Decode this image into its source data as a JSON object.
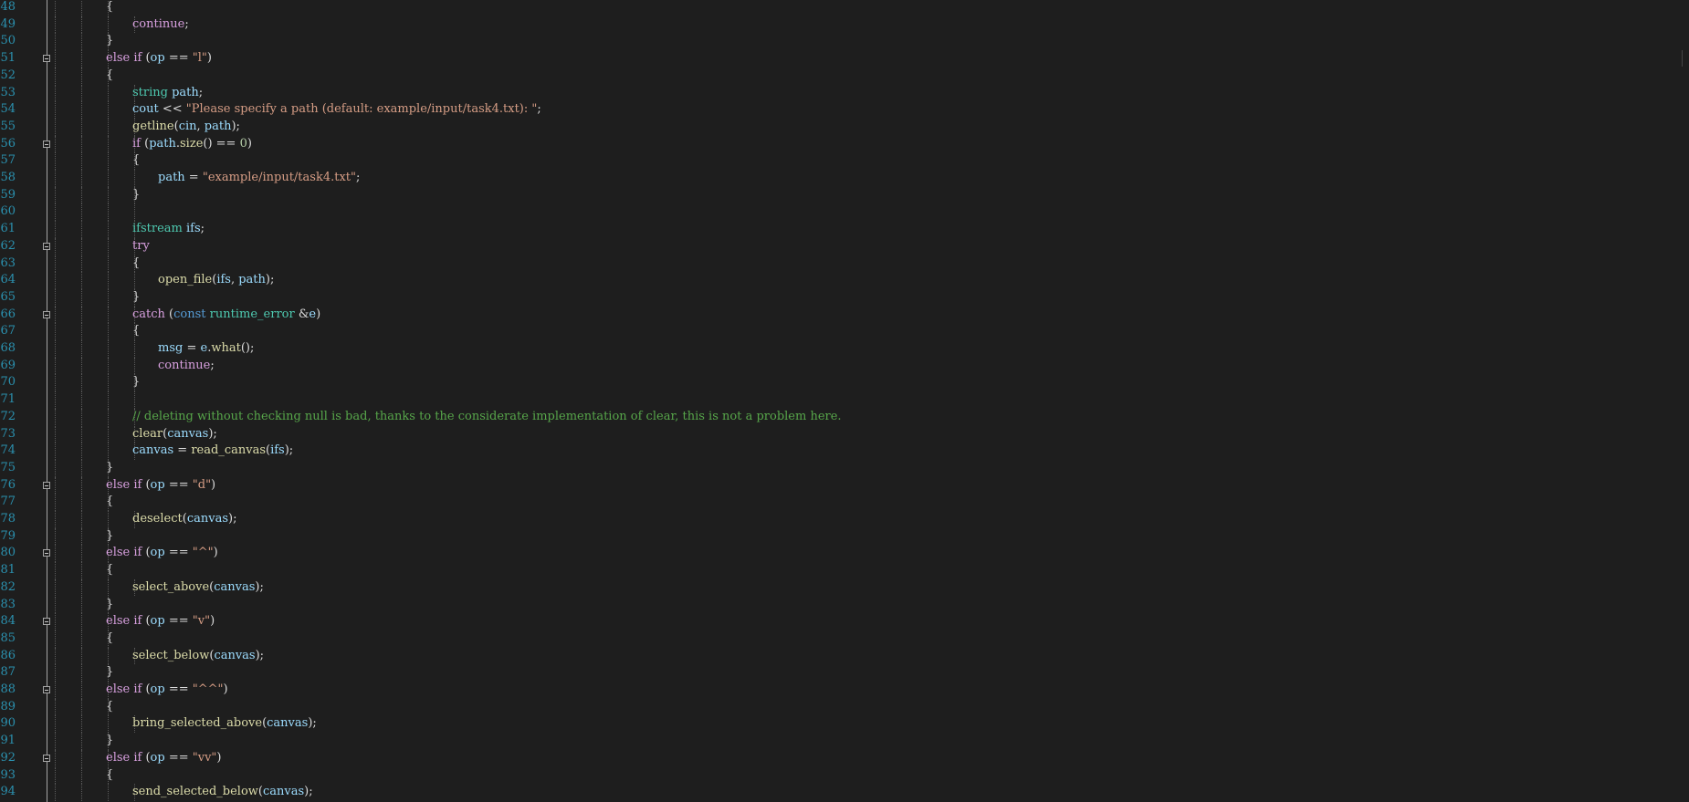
{
  "editor": {
    "lines": [
      {
        "n": "48",
        "indent": 4,
        "fold": false,
        "code": [
          [
            "{",
            "punc"
          ]
        ]
      },
      {
        "n": "49",
        "indent": 5,
        "fold": false,
        "code": [
          [
            "continue",
            "kw"
          ],
          [
            ";",
            "punc"
          ]
        ]
      },
      {
        "n": "50",
        "indent": 4,
        "fold": false,
        "code": [
          [
            "}",
            "punc"
          ]
        ]
      },
      {
        "n": "51",
        "indent": 4,
        "fold": true,
        "code": [
          [
            "else if",
            "kw"
          ],
          [
            " (",
            "punc"
          ],
          [
            "op",
            "var"
          ],
          [
            " == ",
            "punc"
          ],
          [
            "\"l\"",
            "str"
          ],
          [
            ")",
            "punc"
          ]
        ]
      },
      {
        "n": "52",
        "indent": 4,
        "fold": false,
        "code": [
          [
            "{",
            "punc"
          ]
        ]
      },
      {
        "n": "53",
        "indent": 5,
        "fold": false,
        "code": [
          [
            "string",
            "type"
          ],
          [
            " ",
            "punc"
          ],
          [
            "path",
            "var"
          ],
          [
            ";",
            "punc"
          ]
        ]
      },
      {
        "n": "54",
        "indent": 5,
        "fold": false,
        "code": [
          [
            "cout",
            "var"
          ],
          [
            " << ",
            "punc"
          ],
          [
            "\"Please specify a path (default: example/input/task4.txt): \"",
            "str"
          ],
          [
            ";",
            "punc"
          ]
        ]
      },
      {
        "n": "55",
        "indent": 5,
        "fold": false,
        "code": [
          [
            "getline",
            "fn"
          ],
          [
            "(",
            "punc"
          ],
          [
            "cin",
            "var"
          ],
          [
            ", ",
            "punc"
          ],
          [
            "path",
            "var"
          ],
          [
            ");",
            "punc"
          ]
        ]
      },
      {
        "n": "56",
        "indent": 5,
        "fold": true,
        "code": [
          [
            "if",
            "kw"
          ],
          [
            " (",
            "punc"
          ],
          [
            "path",
            "var"
          ],
          [
            ".",
            "punc"
          ],
          [
            "size",
            "fn"
          ],
          [
            "() == ",
            "punc"
          ],
          [
            "0",
            "num"
          ],
          [
            ")",
            "punc"
          ]
        ]
      },
      {
        "n": "57",
        "indent": 5,
        "fold": false,
        "code": [
          [
            "{",
            "punc"
          ]
        ]
      },
      {
        "n": "58",
        "indent": 6,
        "fold": false,
        "code": [
          [
            "path",
            "var"
          ],
          [
            " = ",
            "punc"
          ],
          [
            "\"example/input/task4.txt\"",
            "str"
          ],
          [
            ";",
            "punc"
          ]
        ]
      },
      {
        "n": "59",
        "indent": 5,
        "fold": false,
        "code": [
          [
            "}",
            "punc"
          ]
        ]
      },
      {
        "n": "60",
        "indent": 5,
        "fold": false,
        "code": []
      },
      {
        "n": "61",
        "indent": 5,
        "fold": false,
        "code": [
          [
            "ifstream",
            "type"
          ],
          [
            " ",
            "punc"
          ],
          [
            "ifs",
            "var"
          ],
          [
            ";",
            "punc"
          ]
        ]
      },
      {
        "n": "62",
        "indent": 5,
        "fold": true,
        "code": [
          [
            "try",
            "kw"
          ]
        ]
      },
      {
        "n": "63",
        "indent": 5,
        "fold": false,
        "code": [
          [
            "{",
            "punc"
          ]
        ]
      },
      {
        "n": "64",
        "indent": 6,
        "fold": false,
        "code": [
          [
            "open_file",
            "fn"
          ],
          [
            "(",
            "punc"
          ],
          [
            "ifs",
            "var"
          ],
          [
            ", ",
            "punc"
          ],
          [
            "path",
            "var"
          ],
          [
            ");",
            "punc"
          ]
        ]
      },
      {
        "n": "65",
        "indent": 5,
        "fold": false,
        "code": [
          [
            "}",
            "punc"
          ]
        ]
      },
      {
        "n": "66",
        "indent": 5,
        "fold": true,
        "code": [
          [
            "catch",
            "kw"
          ],
          [
            " (",
            "punc"
          ],
          [
            "const",
            "kwb"
          ],
          [
            " ",
            "punc"
          ],
          [
            "runtime_error",
            "type"
          ],
          [
            " &",
            "punc"
          ],
          [
            "e",
            "var"
          ],
          [
            ")",
            "punc"
          ]
        ]
      },
      {
        "n": "67",
        "indent": 5,
        "fold": false,
        "code": [
          [
            "{",
            "punc"
          ]
        ]
      },
      {
        "n": "68",
        "indent": 6,
        "fold": false,
        "code": [
          [
            "msg",
            "var"
          ],
          [
            " = ",
            "punc"
          ],
          [
            "e",
            "var"
          ],
          [
            ".",
            "punc"
          ],
          [
            "what",
            "fn"
          ],
          [
            "();",
            "punc"
          ]
        ]
      },
      {
        "n": "69",
        "indent": 6,
        "fold": false,
        "code": [
          [
            "continue",
            "kw"
          ],
          [
            ";",
            "punc"
          ]
        ]
      },
      {
        "n": "70",
        "indent": 5,
        "fold": false,
        "code": [
          [
            "}",
            "punc"
          ]
        ]
      },
      {
        "n": "71",
        "indent": 5,
        "fold": false,
        "code": []
      },
      {
        "n": "72",
        "indent": 5,
        "fold": false,
        "code": [
          [
            "// deleting without checking null is bad, thanks to the considerate implementation of clear, this is not a problem here.",
            "cmt"
          ]
        ]
      },
      {
        "n": "73",
        "indent": 5,
        "fold": false,
        "code": [
          [
            "clear",
            "fn"
          ],
          [
            "(",
            "punc"
          ],
          [
            "canvas",
            "var"
          ],
          [
            ");",
            "punc"
          ]
        ]
      },
      {
        "n": "74",
        "indent": 5,
        "fold": false,
        "code": [
          [
            "canvas",
            "var"
          ],
          [
            " = ",
            "punc"
          ],
          [
            "read_canvas",
            "fn"
          ],
          [
            "(",
            "punc"
          ],
          [
            "ifs",
            "var"
          ],
          [
            ");",
            "punc"
          ]
        ]
      },
      {
        "n": "75",
        "indent": 4,
        "fold": false,
        "code": [
          [
            "}",
            "punc"
          ]
        ]
      },
      {
        "n": "76",
        "indent": 4,
        "fold": true,
        "code": [
          [
            "else if",
            "kw"
          ],
          [
            " (",
            "punc"
          ],
          [
            "op",
            "var"
          ],
          [
            " == ",
            "punc"
          ],
          [
            "\"d\"",
            "str"
          ],
          [
            ")",
            "punc"
          ]
        ]
      },
      {
        "n": "77",
        "indent": 4,
        "fold": false,
        "code": [
          [
            "{",
            "punc"
          ]
        ]
      },
      {
        "n": "78",
        "indent": 5,
        "fold": false,
        "code": [
          [
            "deselect",
            "fn"
          ],
          [
            "(",
            "punc"
          ],
          [
            "canvas",
            "var"
          ],
          [
            ");",
            "punc"
          ]
        ]
      },
      {
        "n": "79",
        "indent": 4,
        "fold": false,
        "code": [
          [
            "}",
            "punc"
          ]
        ]
      },
      {
        "n": "80",
        "indent": 4,
        "fold": true,
        "code": [
          [
            "else if",
            "kw"
          ],
          [
            " (",
            "punc"
          ],
          [
            "op",
            "var"
          ],
          [
            " == ",
            "punc"
          ],
          [
            "\"^\"",
            "str"
          ],
          [
            ")",
            "punc"
          ]
        ]
      },
      {
        "n": "81",
        "indent": 4,
        "fold": false,
        "code": [
          [
            "{",
            "punc"
          ]
        ]
      },
      {
        "n": "82",
        "indent": 5,
        "fold": false,
        "code": [
          [
            "select_above",
            "fn"
          ],
          [
            "(",
            "punc"
          ],
          [
            "canvas",
            "var"
          ],
          [
            ");",
            "punc"
          ]
        ]
      },
      {
        "n": "83",
        "indent": 4,
        "fold": false,
        "code": [
          [
            "}",
            "punc"
          ]
        ]
      },
      {
        "n": "84",
        "indent": 4,
        "fold": true,
        "code": [
          [
            "else if",
            "kw"
          ],
          [
            " (",
            "punc"
          ],
          [
            "op",
            "var"
          ],
          [
            " == ",
            "punc"
          ],
          [
            "\"v\"",
            "str"
          ],
          [
            ")",
            "punc"
          ]
        ]
      },
      {
        "n": "85",
        "indent": 4,
        "fold": false,
        "code": [
          [
            "{",
            "punc"
          ]
        ]
      },
      {
        "n": "86",
        "indent": 5,
        "fold": false,
        "code": [
          [
            "select_below",
            "fn"
          ],
          [
            "(",
            "punc"
          ],
          [
            "canvas",
            "var"
          ],
          [
            ");",
            "punc"
          ]
        ]
      },
      {
        "n": "87",
        "indent": 4,
        "fold": false,
        "code": [
          [
            "}",
            "punc"
          ]
        ]
      },
      {
        "n": "88",
        "indent": 4,
        "fold": true,
        "code": [
          [
            "else if",
            "kw"
          ],
          [
            " (",
            "punc"
          ],
          [
            "op",
            "var"
          ],
          [
            " == ",
            "punc"
          ],
          [
            "\"^^\"",
            "str"
          ],
          [
            ")",
            "punc"
          ]
        ]
      },
      {
        "n": "89",
        "indent": 4,
        "fold": false,
        "code": [
          [
            "{",
            "punc"
          ]
        ]
      },
      {
        "n": "90",
        "indent": 5,
        "fold": false,
        "code": [
          [
            "bring_selected_above",
            "fn"
          ],
          [
            "(",
            "punc"
          ],
          [
            "canvas",
            "var"
          ],
          [
            ");",
            "punc"
          ]
        ]
      },
      {
        "n": "91",
        "indent": 4,
        "fold": false,
        "code": [
          [
            "}",
            "punc"
          ]
        ]
      },
      {
        "n": "92",
        "indent": 4,
        "fold": true,
        "code": [
          [
            "else if",
            "kw"
          ],
          [
            " (",
            "punc"
          ],
          [
            "op",
            "var"
          ],
          [
            " == ",
            "punc"
          ],
          [
            "\"vv\"",
            "str"
          ],
          [
            ")",
            "punc"
          ]
        ]
      },
      {
        "n": "93",
        "indent": 4,
        "fold": false,
        "code": [
          [
            "{",
            "punc"
          ]
        ]
      },
      {
        "n": "94",
        "indent": 5,
        "fold": false,
        "code": [
          [
            "send_selected_below",
            "fn"
          ],
          [
            "(",
            "punc"
          ],
          [
            "canvas",
            "var"
          ],
          [
            ");",
            "punc"
          ]
        ]
      }
    ]
  },
  "colors": {
    "background": "#1e1e1e",
    "line_number": "#2b91af",
    "kw": "#d8a0df",
    "kwb": "#569cd6",
    "type": "#4ec9b0",
    "var": "#9cdcfe",
    "fn": "#dcdcaa",
    "str": "#d69d85",
    "num": "#b5cea8",
    "cmt": "#57a64a",
    "punc": "#dcdcdc"
  }
}
